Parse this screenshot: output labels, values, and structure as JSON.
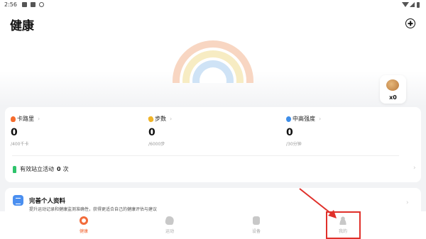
{
  "status_bar": {
    "time": "2:56"
  },
  "header": {
    "title": "健康",
    "add_button": "add-icon"
  },
  "rings": {
    "colors": [
      "#f8d6c2",
      "#f7ecc3",
      "#cfe3f6"
    ]
  },
  "coins": {
    "count": "x0",
    "icon": "coin-icon"
  },
  "stats": {
    "calories": {
      "label": "卡路里",
      "value": "0",
      "goal": "/400千卡",
      "icon": "fire-icon"
    },
    "steps": {
      "label": "步数",
      "value": "0",
      "goal": "/6000步",
      "icon": "steps-icon"
    },
    "intensity": {
      "label": "中高强度",
      "value": "0",
      "goal": "/30分钟",
      "icon": "clock-icon"
    },
    "stand": {
      "label": "有效站立活动",
      "value": "0",
      "unit": "次",
      "icon": "stand-icon"
    }
  },
  "profile_card": {
    "title": "完善个人资料",
    "description": "提升运动记录和健康监测准确性，获得更适合自己的健康评估与建议"
  },
  "bottom_nav": [
    {
      "label": "健康",
      "icon": "health-ring-icon",
      "active": true
    },
    {
      "label": "运动",
      "icon": "run-icon",
      "active": false
    },
    {
      "label": "设备",
      "icon": "watch-icon",
      "active": false
    },
    {
      "label": "我的",
      "icon": "person-icon",
      "active": false
    }
  ],
  "colors": {
    "accent": "#f26b3a",
    "annotation": "#e0302a"
  }
}
